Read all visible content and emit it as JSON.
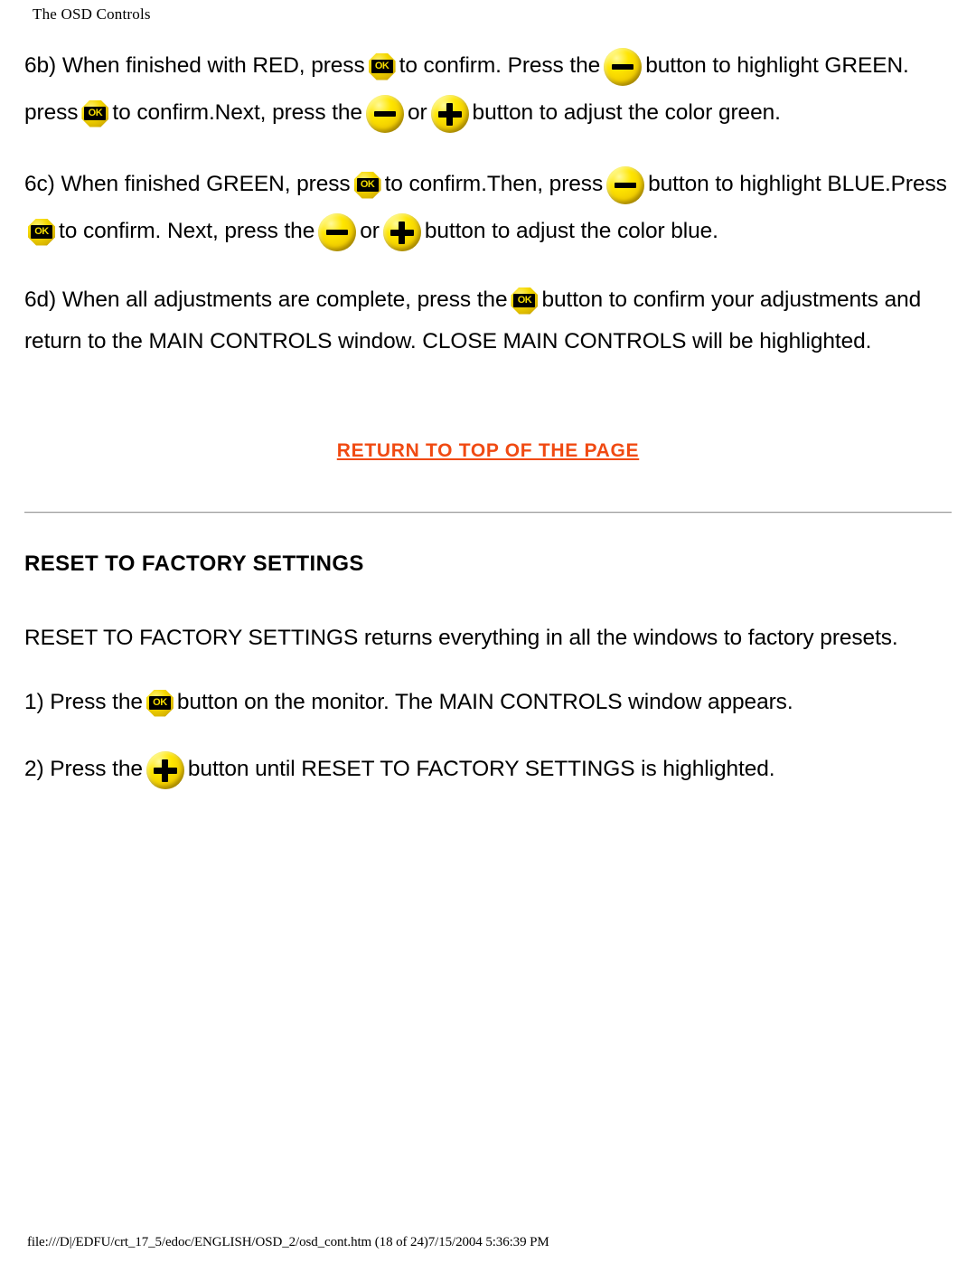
{
  "header": {
    "title": "The OSD Controls"
  },
  "icons": {
    "ok": "ok-button-icon",
    "minus": "minus-button-icon",
    "plus": "plus-button-icon",
    "ok_label": "OK"
  },
  "colors": {
    "link": "#f04a12",
    "button_gold": "#ffe600",
    "button_symbol": "#000000",
    "divider": "#9a9a9a",
    "text": "#000000"
  },
  "body": {
    "step_6b": {
      "line1_a": "6b) When finished with RED, press",
      "line1_b": "to confirm. Press the",
      "line1_c": "button to highlight GREEN.",
      "line2_a": "press",
      "line2_b": "to confirm.Next, press the",
      "line2_c": "or",
      "line2_d": "button to adjust the color green."
    },
    "step_6c": {
      "line1_a": "6c) When finished GREEN, press",
      "line1_b": "to confirm.Then, press",
      "line1_c": "button to highlight BLUE.Press",
      "line2_a": "to confirm. Next, press the",
      "line2_b": "or",
      "line2_c": "button to adjust the color blue."
    },
    "step_6d": {
      "line1_a": "6d) When all adjustments are complete, press the",
      "line1_b": "button to confirm your adjustments and",
      "line2": "return to the MAIN CONTROLS window. CLOSE MAIN CONTROLS will be highlighted."
    }
  },
  "return_link": {
    "label": "RETURN TO TOP OF THE PAGE"
  },
  "section": {
    "title": "RESET TO FACTORY SETTINGS",
    "description": "RESET TO FACTORY SETTINGS returns everything in all the windows to factory presets.",
    "step_1_a": "1) Press the",
    "step_1_b": "button on the monitor. The MAIN CONTROLS window appears.",
    "step_2_a": "2) Press the",
    "step_2_b": "button until RESET TO FACTORY SETTINGS is highlighted."
  },
  "footer": {
    "path": "file:///D|/EDFU/crt_17_5/edoc/ENGLISH/OSD_2/osd_cont.htm (18 of 24)7/15/2004 5:36:39 PM"
  }
}
